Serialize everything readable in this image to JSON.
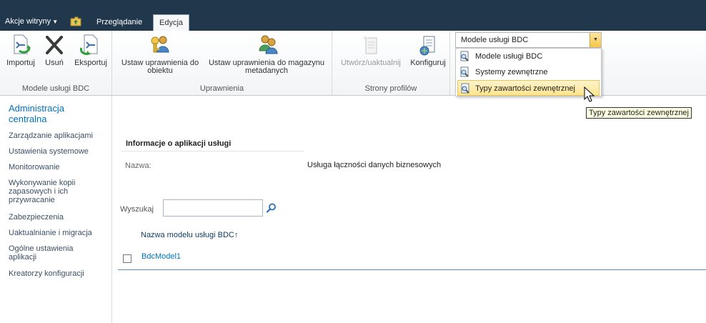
{
  "topbar": {
    "site_actions": "Akcje witryny",
    "tabs": [
      {
        "label": "Przeglądanie"
      },
      {
        "label": "Edycja",
        "selected": true
      }
    ]
  },
  "ribbon": {
    "groups": [
      {
        "label": "Modele usługi BDC",
        "buttons": [
          {
            "label": "Importuj",
            "icon": "import-icon"
          },
          {
            "label": "Usuń",
            "icon": "delete-icon"
          },
          {
            "label": "Eksportuj",
            "icon": "export-icon"
          }
        ]
      },
      {
        "label": "Uprawnienia",
        "buttons": [
          {
            "label1": "Ustaw uprawnienia do",
            "label2": "obiektu",
            "icon": "object-permissions-icon"
          },
          {
            "label1": "Ustaw uprawnienia do magazynu",
            "label2": "metadanych",
            "icon": "metadata-permissions-icon"
          }
        ]
      },
      {
        "label": "Strony profilów",
        "buttons": [
          {
            "label": "Utwórz/uaktualnij",
            "icon": "create-upgrade-icon",
            "disabled": true
          },
          {
            "label": "Konfiguruj",
            "icon": "configure-icon"
          }
        ]
      }
    ]
  },
  "view_dropdown": {
    "selected": "Modele usługi BDC",
    "options": [
      {
        "label": "Modele usługi BDC"
      },
      {
        "label": "Systemy zewnętrzne"
      },
      {
        "label": "Typy zawartości zewnętrznej",
        "highlighted": true
      }
    ],
    "tooltip": "Typy zawartości zewnętrznej"
  },
  "leftnav": {
    "heading": "Administracja centralna",
    "items": [
      {
        "label": "Zarządzanie aplikacjami"
      },
      {
        "label": "Ustawienia systemowe"
      },
      {
        "label": "Monitorowanie"
      },
      {
        "label": "Wykonywanie kopii zapasowych i ich przywracanie"
      },
      {
        "label": "Zabezpieczenia"
      },
      {
        "label": "Uaktualnianie i migracja"
      },
      {
        "label": "Ogólne ustawienia aplikacji"
      },
      {
        "label": "Kreatorzy konfiguracji"
      }
    ]
  },
  "main": {
    "info_title": "Informacje o aplikacji usługi",
    "name_label": "Nazwa:",
    "name_value": "Usługa łączności danych biznesowych",
    "search_label": "Wyszukaj",
    "search_value": "",
    "column_header": "Nazwa modelu usługi BDC↑",
    "rows": [
      {
        "name": "BdcModel1"
      }
    ]
  },
  "colors": {
    "topbar": "#21374c",
    "link": "#0072bc",
    "highlight": "#fde58e"
  }
}
